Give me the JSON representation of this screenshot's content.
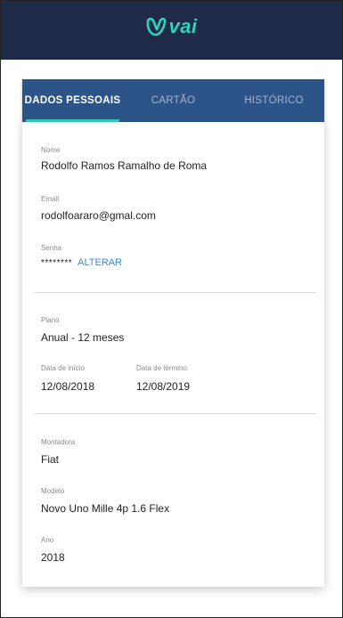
{
  "app": {
    "logo_text": "vai",
    "brand_color": "#2fd3b8",
    "header_color": "#1f2a48",
    "tabbar_color": "#2d5489"
  },
  "tabs": [
    {
      "label": "DADOS PESSOAIS",
      "active": true
    },
    {
      "label": "CARTÃO",
      "active": false
    },
    {
      "label": "HISTÓRICO",
      "active": false
    }
  ],
  "personal": {
    "name_label": "Nome",
    "name_value": "Rodolfo Ramos Ramalho de Roma",
    "email_label": "Email",
    "email_value": "rodolfoararo@gmal.com",
    "password_label": "Senha",
    "password_value": "********",
    "change_link": "ALTERAR"
  },
  "plan": {
    "plan_label": "Plano",
    "plan_value": "Anual - 12 meses",
    "start_label": "Data de início",
    "start_value": "12/08/2018",
    "end_label": "Data de término",
    "end_value": "12/08/2019"
  },
  "vehicle": {
    "brand_label": "Montadora",
    "brand_value": "Fiat",
    "model_label": "Modelo",
    "model_value": "Novo Uno Mille 4p 1.6 Flex",
    "year_label": "Ano",
    "year_value": "2018"
  }
}
